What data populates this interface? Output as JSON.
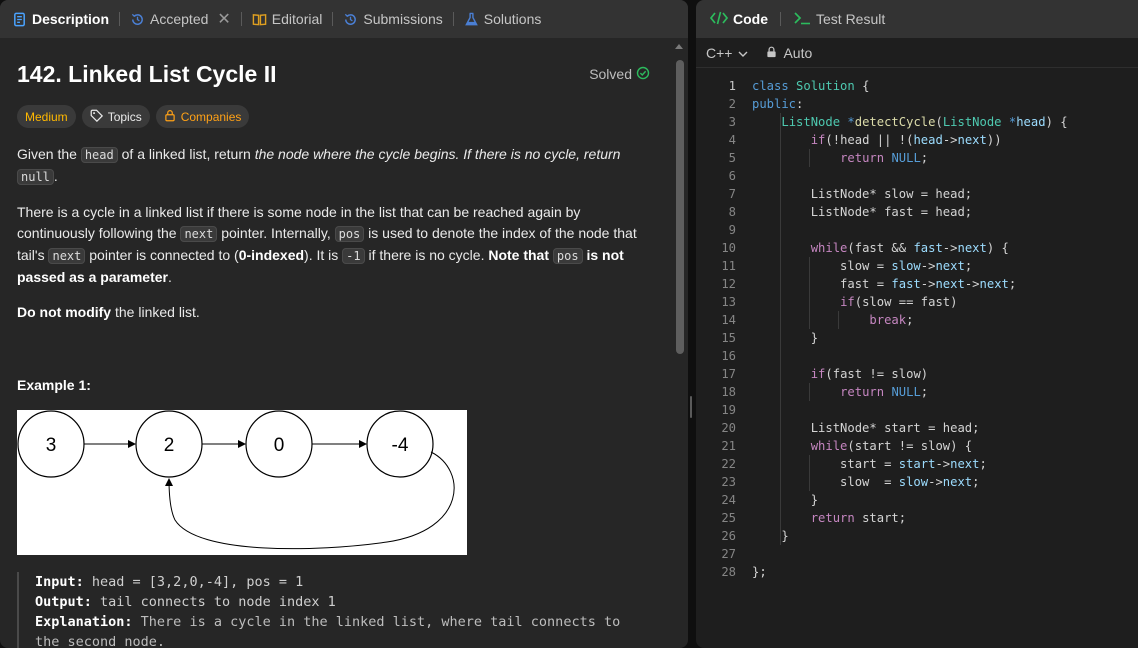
{
  "left_tabs": {
    "description": "Description",
    "accepted": "Accepted",
    "editorial": "Editorial",
    "submissions": "Submissions",
    "solutions": "Solutions"
  },
  "problem": {
    "title": "142. Linked List Cycle II",
    "status": "Solved",
    "tags": {
      "difficulty": "Medium",
      "topics": "Topics",
      "companies": "Companies"
    }
  },
  "description": {
    "p1": {
      "a": "Given the ",
      "code_head": "head",
      "b": " of a linked list, return ",
      "em": "the node where the cycle begins. If there is no cycle, return ",
      "code_null": "null",
      "c": "."
    },
    "p2": {
      "a": "There is a cycle in a linked list if there is some node in the list that can be reached again by continuously following the ",
      "code_next": "next",
      "b": " pointer. Internally, ",
      "code_pos": "pos",
      "c": " is used to denote the index of the node that tail's ",
      "code_next2": "next",
      "d": " pointer is connected to (",
      "bold_idx": "0-indexed",
      "e": "). It is ",
      "code_neg": "-1",
      "f": " if there is no cycle. ",
      "bold_note": "Note that ",
      "code_pos2": "pos",
      "bold_note2": " is not passed as a parameter",
      "g": "."
    },
    "p3": {
      "bold": "Do not modify",
      "rest": " the linked list."
    }
  },
  "example": {
    "title": "Example 1:",
    "nodes": [
      "3",
      "2",
      "0",
      "-4"
    ],
    "input_label": "Input:",
    "input_value": " head = [3,2,0,-4], pos = 1",
    "output_label": "Output:",
    "output_value": " tail connects to node index 1",
    "explanation_label": "Explanation:",
    "explanation_value": " There is a cycle in the linked list, where tail connects to",
    "explanation_value2": "the second node."
  },
  "right_tabs": {
    "code": "Code",
    "test_result": "Test Result"
  },
  "toolbar": {
    "language": "C++",
    "mode": "Auto"
  },
  "colors": {
    "medium": "#ffb800",
    "solved": "#2cbb5d",
    "accent": "#ffa116"
  }
}
